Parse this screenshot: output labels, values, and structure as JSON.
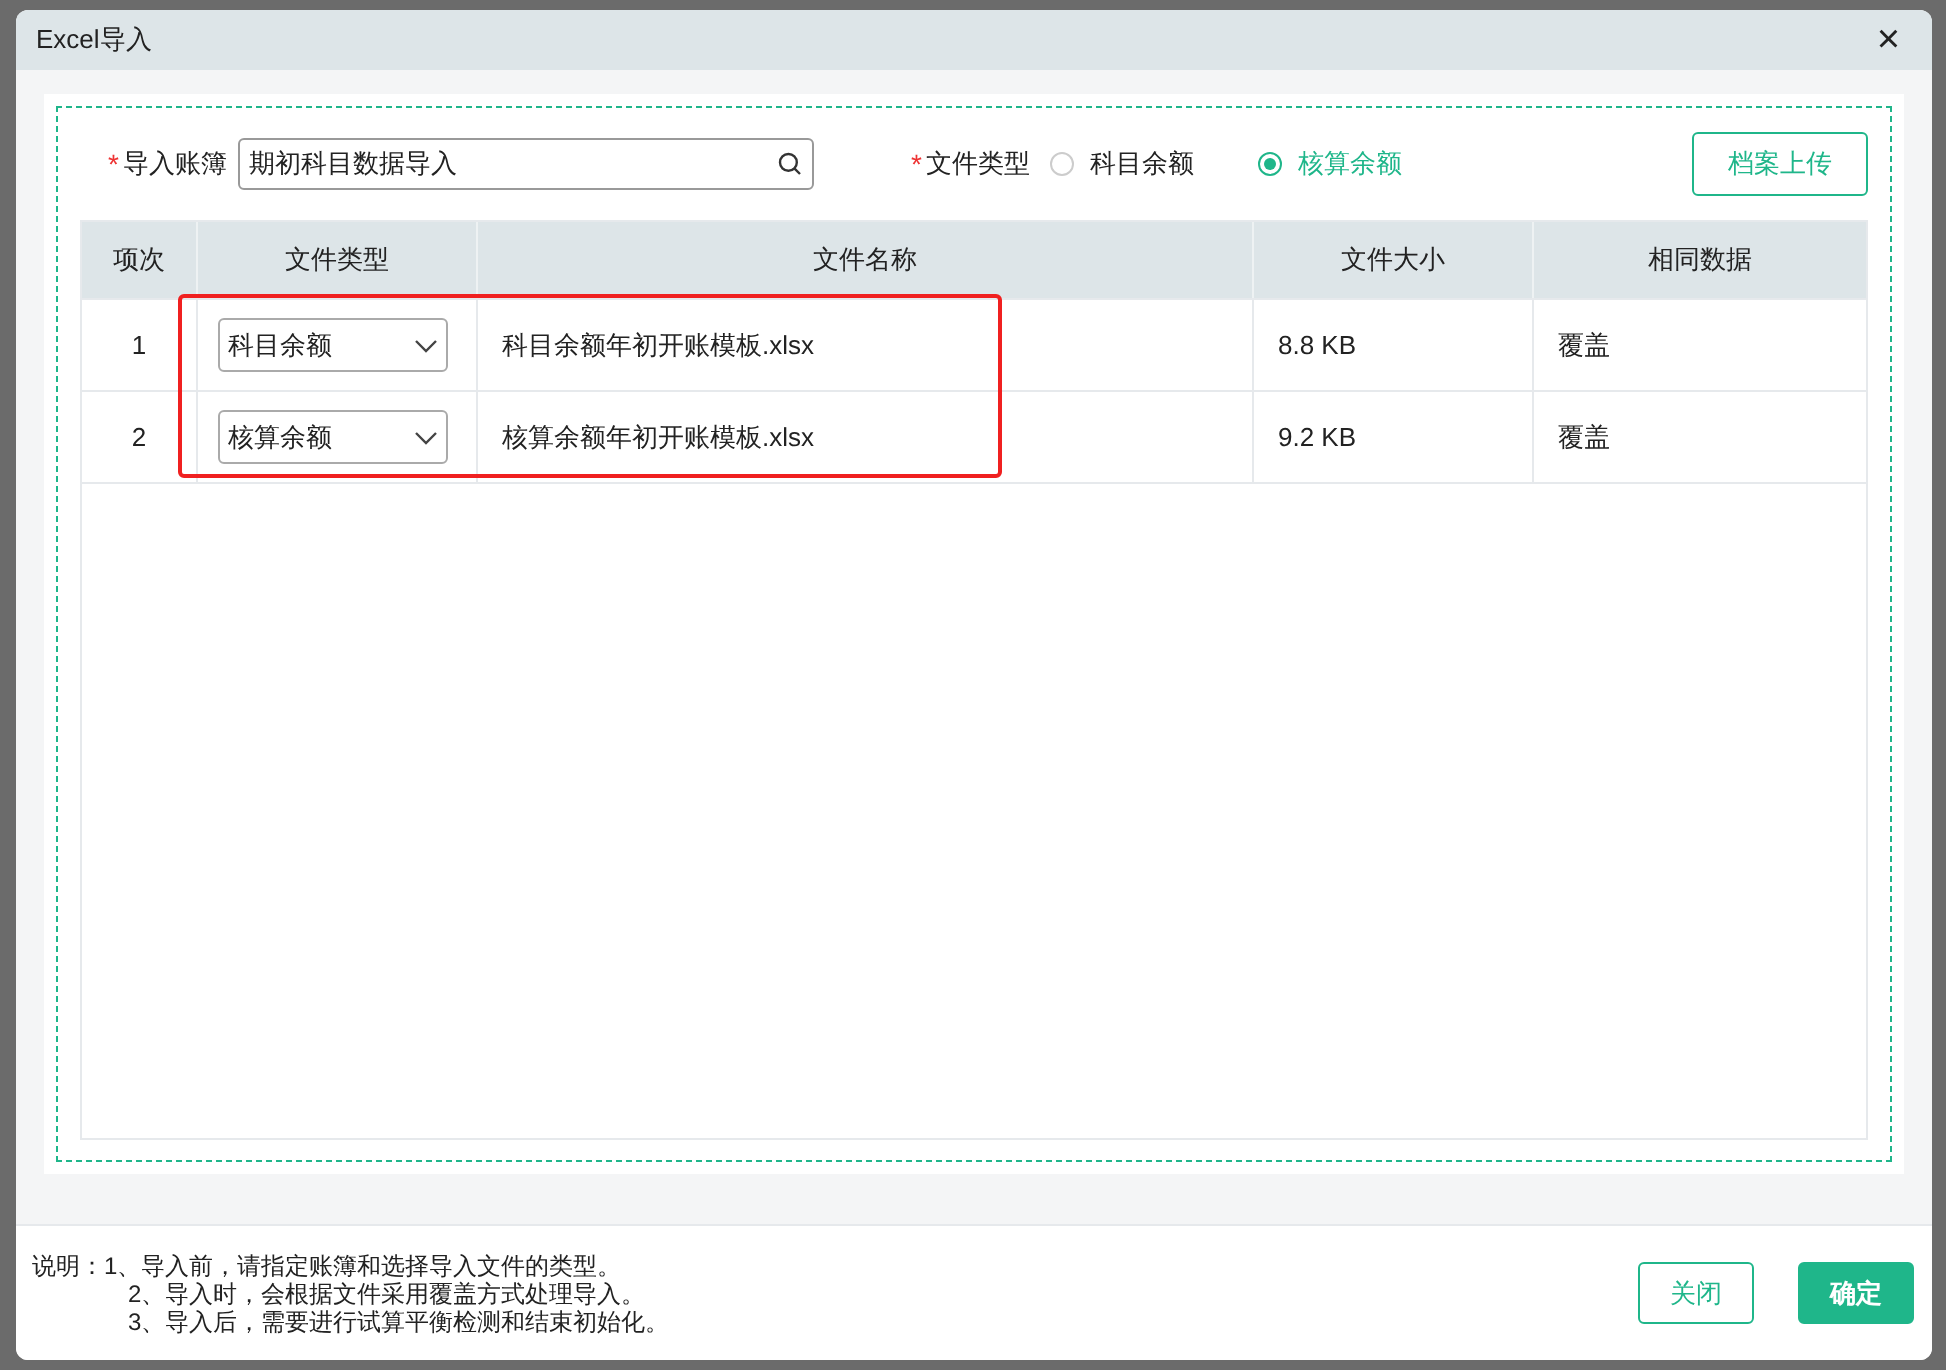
{
  "window": {
    "title": "Excel导入",
    "close": "×"
  },
  "form": {
    "required_mark": "*",
    "ledger_label": "导入账簿",
    "ledger_value": "期初科目数据导入",
    "type_label": "文件类型",
    "type_options": [
      {
        "label": "科目余额",
        "selected": false
      },
      {
        "label": "核算余额",
        "selected": true
      }
    ],
    "upload_button": "档案上传"
  },
  "table": {
    "columns": [
      "项次",
      "文件类型",
      "文件名称",
      "文件大小",
      "相同数据"
    ],
    "rows": [
      {
        "index": "1",
        "type": "科目余额",
        "name": "科目余额年初开账模板.xlsx",
        "size": "8.8 KB",
        "same": "覆盖"
      },
      {
        "index": "2",
        "type": "核算余额",
        "name": "核算余额年初开账模板.xlsx",
        "size": "9.2 KB",
        "same": "覆盖"
      }
    ]
  },
  "notes": {
    "label": "说明：",
    "lines": [
      "1、导入前，请指定账簿和选择导入文件的类型。",
      "2、导入时，会根据文件采用覆盖方式处理导入。",
      "3、导入后，需要进行试算平衡检测和结束初始化。"
    ]
  },
  "buttons": {
    "close": "关闭",
    "confirm": "确定"
  }
}
